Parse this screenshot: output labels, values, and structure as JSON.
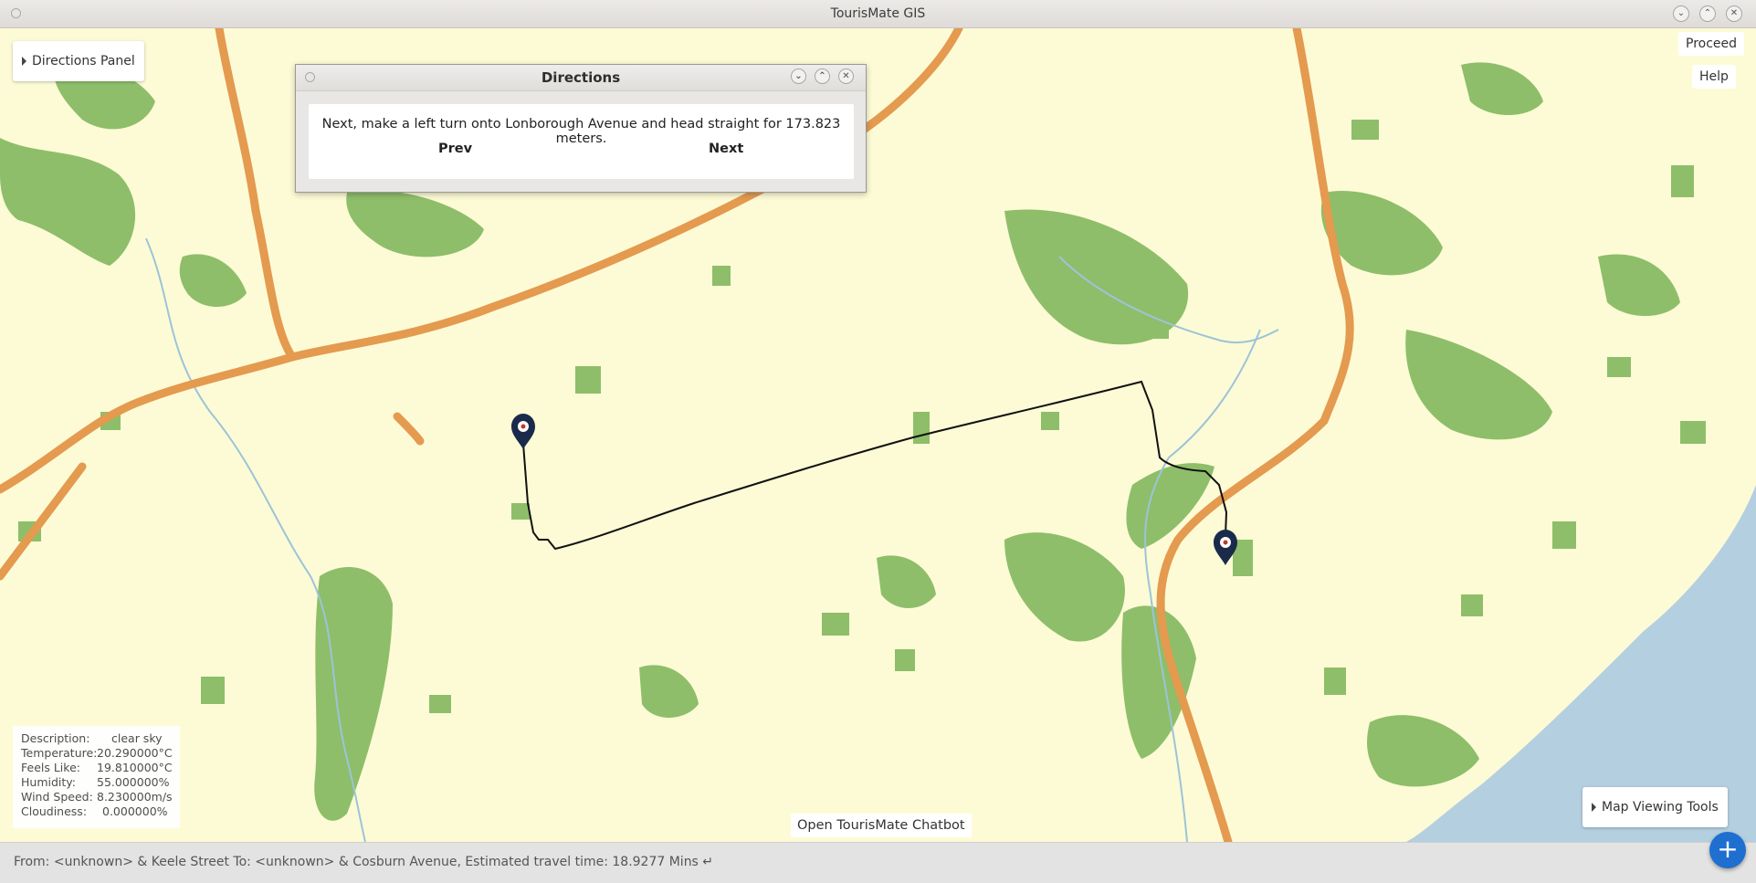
{
  "window": {
    "title": "TourisMate GIS"
  },
  "controls": {
    "directions_panel": "Directions Panel",
    "proceed": "Proceed",
    "help": "Help",
    "map_viewing_tools": "Map Viewing Tools",
    "chatbot": "Open TourisMate Chatbot",
    "fab": "+"
  },
  "directions_dialog": {
    "title": "Directions",
    "message": "Next, make a left turn onto Lonborough Avenue and head straight for 173.823 meters.",
    "prev": "Prev",
    "next": "Next"
  },
  "weather": [
    {
      "label": "Description:",
      "value": "clear sky"
    },
    {
      "label": "Temperature:",
      "value": "20.290000°C"
    },
    {
      "label": "Feels Like:",
      "value": "19.810000°C"
    },
    {
      "label": "Humidity:",
      "value": "55.000000%"
    },
    {
      "label": "Wind Speed:",
      "value": "8.230000m/s"
    },
    {
      "label": "Cloudiness:",
      "value": "0.000000%"
    }
  ],
  "status_bar": "From: <unknown> & Keele Street To: <unknown> & Cosburn Avenue, Estimated travel time: 18.9277 Mins ↵",
  "colors": {
    "land": "#fdfbd5",
    "park": "#8ebe6a",
    "highway": "#e49a4f",
    "water": "#b4cfe0",
    "route": "#111111",
    "marker": "#1a2a4a",
    "fab": "#1e6fd0"
  }
}
